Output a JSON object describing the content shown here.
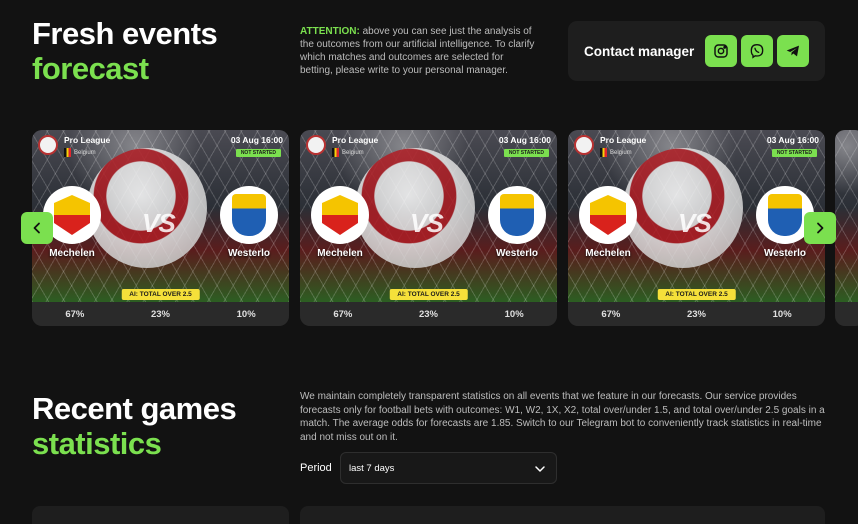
{
  "forecast": {
    "title_line1": "Fresh events",
    "title_line2": "forecast",
    "attention_label": "ATTENTION:",
    "attention_text": " above you can see just the analysis of the outcomes from our artificial intelligence. To clarify which matches and outcomes are selected for betting, please write to your personal manager."
  },
  "contact": {
    "label": "Contact manager",
    "icons": [
      "instagram-icon",
      "viber-icon",
      "telegram-icon"
    ],
    "accent": "#7be04f"
  },
  "cards": [
    {
      "league": "Pro League",
      "country": "Belgium",
      "date": "03 Aug 16:00",
      "status": "NOT STARTED",
      "home": "Mechelen",
      "away": "Westerlo",
      "vs": "VS",
      "prediction": "AI: TOTAL OVER 2.5",
      "odds": [
        "67%",
        "23%",
        "10%"
      ]
    },
    {
      "league": "Pro League",
      "country": "Belgium",
      "date": "03 Aug 16:00",
      "status": "NOT STARTED",
      "home": "Mechelen",
      "away": "Westerlo",
      "vs": "VS",
      "prediction": "AI: TOTAL OVER 2.5",
      "odds": [
        "67%",
        "23%",
        "10%"
      ]
    },
    {
      "league": "Pro League",
      "country": "Belgium",
      "date": "03 Aug 16:00",
      "status": "NOT STARTED",
      "home": "Mechelen",
      "away": "Westerlo",
      "vs": "VS",
      "prediction": "AI: TOTAL OVER 2.5",
      "odds": [
        "67%",
        "23%",
        "10%"
      ]
    }
  ],
  "stats": {
    "title_line1": "Recent games",
    "title_line2": "statistics",
    "description": "We maintain completely transparent statistics on all events that we feature in our forecasts. Our service provides forecasts only for football bets with outcomes: W1, W2, 1X, X2, total over/under 1.5, and total over/under 2.5 goals in a match. The average odds for forecasts are 1.85. Switch to our Telegram bot to conveniently track statistics in real-time and not miss out on it.",
    "period_label": "Period",
    "period_value": "last 7 days"
  }
}
